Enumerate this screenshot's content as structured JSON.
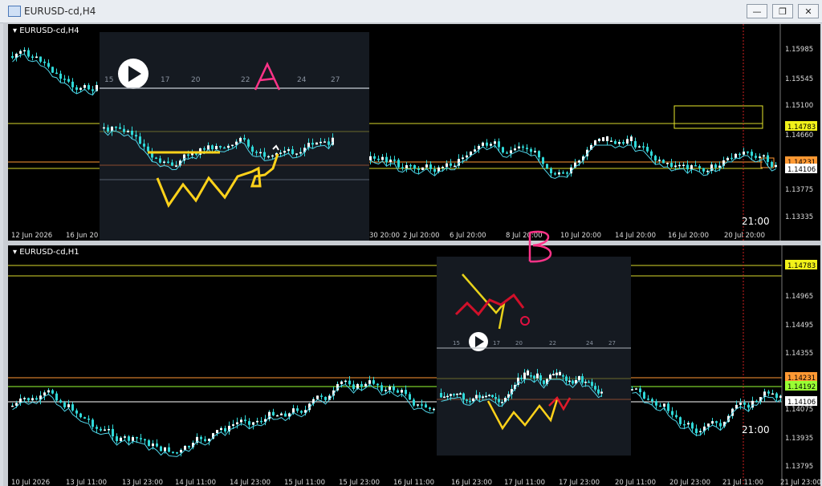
{
  "window": {
    "title": "EURUSD-cd,H4",
    "minimize": "—",
    "restore": "❐",
    "close": "✕"
  },
  "chart_data": [
    {
      "type": "candlestick",
      "title": "EURUSD-cd,H4",
      "y_ticks": [
        "1.15985",
        "1.15545",
        "1.15100",
        "1.14660",
        "1.14231",
        "1.14106",
        "1.13775",
        "1.13335"
      ],
      "x_ticks": [
        "12 Jun 2026",
        "16 Jun 20",
        "30 20:00",
        "2 Jul 20:00",
        "6 Jul 20:00",
        "8 Jul 20:00",
        "10 Jul 20:00",
        "14 Jul 20:00",
        "16 Jul 20:00",
        "20 Jul 20:00"
      ],
      "price_labels": [
        {
          "text": "1.14783",
          "color": "#f2f21a"
        },
        {
          "text": "1.14231",
          "color": "#ff9933"
        },
        {
          "text": "1.14106",
          "color": "#ffffff"
        }
      ],
      "time_marker": "21:00"
    },
    {
      "type": "candlestick",
      "title": "EURUSD-cd,H1",
      "y_ticks": [
        "1.14965",
        "1.14495",
        "1.14355",
        "1.14192",
        "1.14075",
        "1.13935",
        "1.13795"
      ],
      "x_ticks": [
        "10 Jul 2026",
        "13 Jul 11:00",
        "13 Jul 23:00",
        "14 Jul 11:00",
        "14 Jul 23:00",
        "15 Jul 11:00",
        "15 Jul 23:00",
        "16 Jul 11:00",
        "16 Jul 23:00",
        "17 Jul 11:00",
        "17 Jul 23:00",
        "20 Jul 11:00",
        "20 Jul 23:00",
        "21 Jul 11:00",
        "21 Jul 23:00"
      ],
      "price_labels": [
        {
          "text": "1.14783",
          "color": "#f2f21a"
        },
        {
          "text": "1.14231",
          "color": "#ff9933"
        },
        {
          "text": "1.14192",
          "color": "#99ff33"
        },
        {
          "text": "1.14106",
          "color": "#ffffff"
        }
      ],
      "time_marker": "21:00"
    }
  ],
  "annotations": {
    "a": "A",
    "b": "B"
  },
  "video_a": {
    "days": [
      "15",
      "17",
      "20",
      "22",
      "24",
      "27"
    ]
  },
  "video_b": {
    "days": [
      "15",
      "17",
      "20",
      "22",
      "24",
      "27"
    ]
  }
}
